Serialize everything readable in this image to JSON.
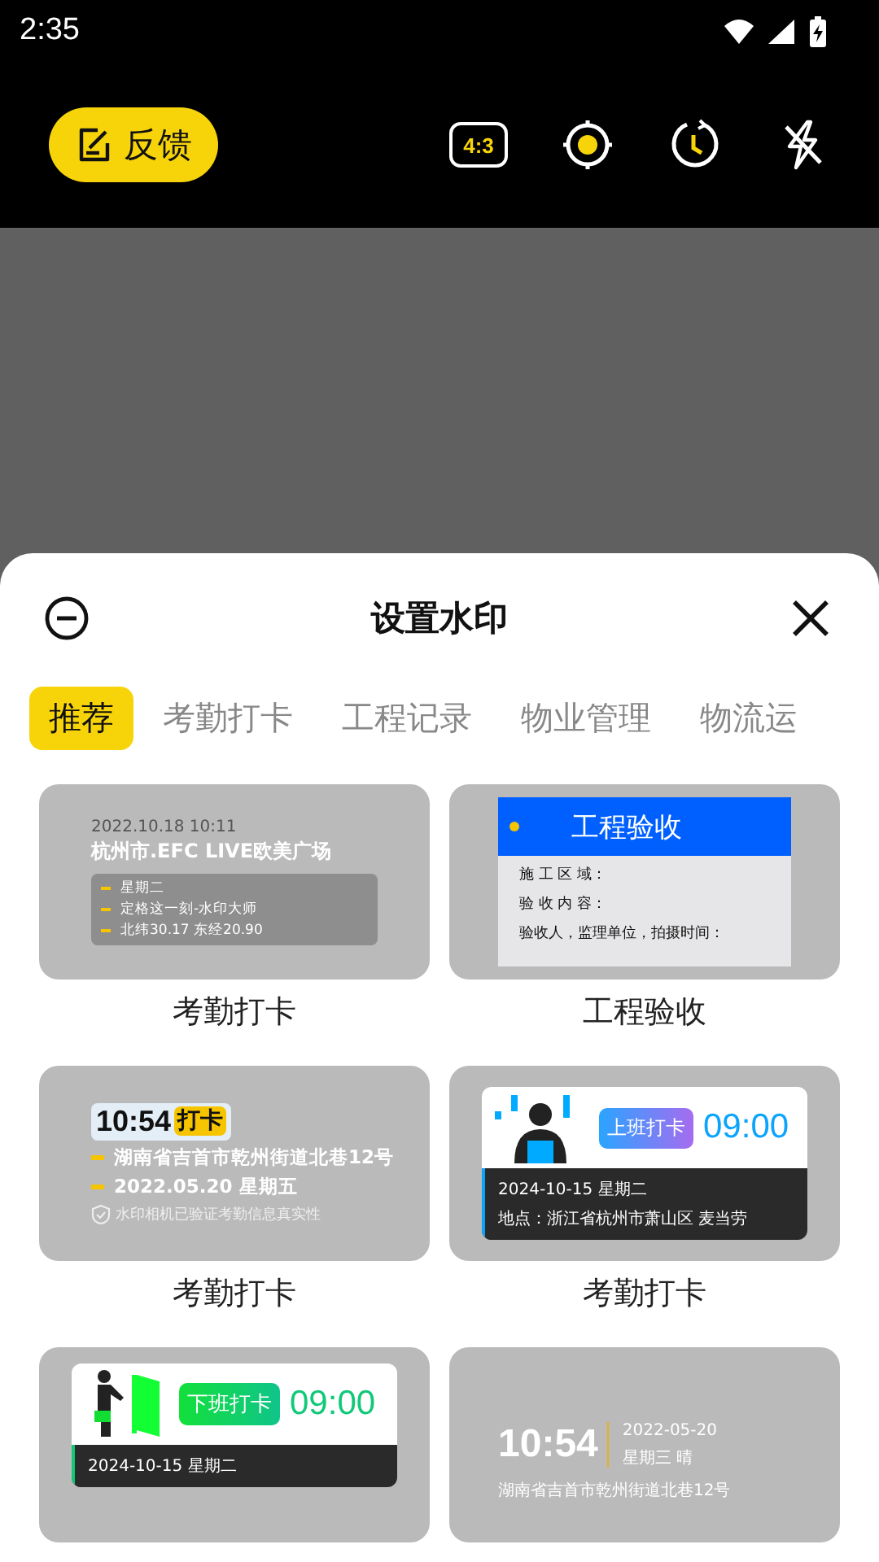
{
  "status_bar": {
    "time": "2:35"
  },
  "toolbar": {
    "feedback_button": "反馈",
    "aspect_ratio": "4:3"
  },
  "sheet": {
    "title": "设置水印",
    "tabs": [
      {
        "label": "推荐",
        "selected": true
      },
      {
        "label": "考勤打卡",
        "selected": false
      },
      {
        "label": "工程记录",
        "selected": false
      },
      {
        "label": "物业管理",
        "selected": false
      },
      {
        "label": "物流运",
        "selected": false
      }
    ],
    "templates": [
      {
        "kind": "location",
        "label": "考勤打卡",
        "time": "2022.10.18 10:11",
        "place": "杭州市.EFC LIVE欧美广场",
        "lines": [
          "星期二",
          "定格这一刻-水印大师",
          "北纬30.17 东经20.90"
        ]
      },
      {
        "kind": "engineering",
        "label": "工程验收",
        "title": "工程验收",
        "fields": [
          "施 工 区 域：",
          "验 收 内 容：",
          "验收人，监理单位，拍摄时间："
        ]
      },
      {
        "kind": "clock_in",
        "label": "考勤打卡",
        "time": "10:54",
        "tag": "打卡",
        "lines": [
          "湖南省吉首市乾州街道北巷12号",
          "2022.05.20 星期五"
        ],
        "note": "水印相机已验证考勤信息真实性"
      },
      {
        "kind": "on_duty",
        "label": "考勤打卡",
        "badge": "上班打卡",
        "time": "09:00",
        "date": "2024-10-15 星期二",
        "place": "地点：浙江省杭州市萧山区 麦当劳"
      },
      {
        "kind": "off_duty",
        "badge": "下班打卡",
        "time": "09:00",
        "date": "2024-10-15 星期二"
      },
      {
        "kind": "time_weather",
        "time": "10:54",
        "date": "2022-05-20",
        "weather": "星期三 晴",
        "address": "湖南省吉首市乾州街道北巷12号"
      }
    ]
  }
}
